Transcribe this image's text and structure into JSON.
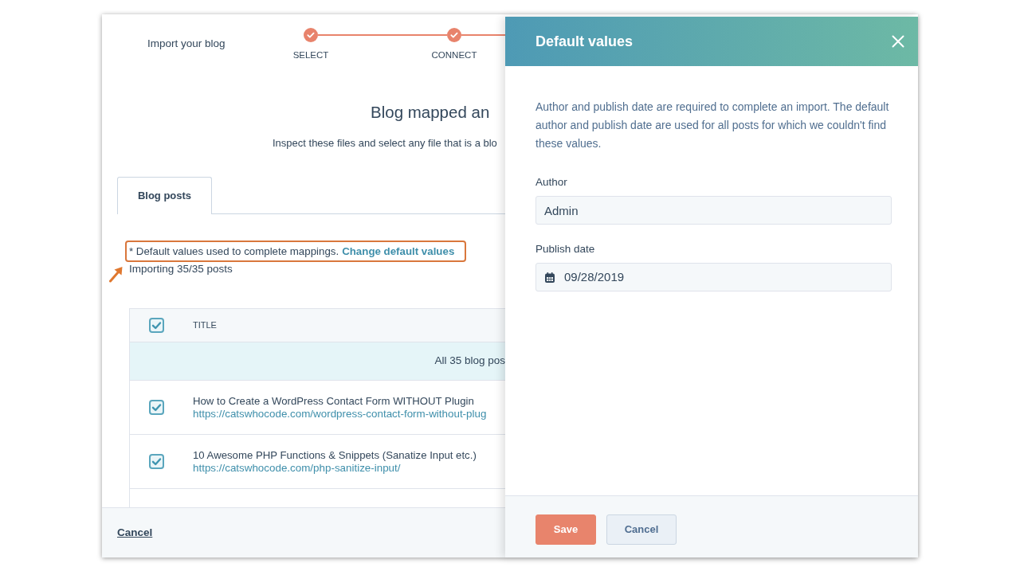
{
  "wizard": {
    "title": "Import your blog",
    "steps": [
      {
        "label": "SELECT",
        "completed": true
      },
      {
        "label": "CONNECT",
        "completed": true
      }
    ]
  },
  "heading": "Blog mapped an",
  "subheading": "Inspect these files and select any file that is a blo",
  "tabs": [
    {
      "label": "Blog posts",
      "selected": true
    }
  ],
  "notice": {
    "text": "* Default values used to complete mappings.",
    "link": "Change default values",
    "highlighted": true
  },
  "import_status": "Importing 35/35 posts",
  "table": {
    "header_checked": true,
    "columns": [
      "TITLE"
    ],
    "banner": "All 35 blog pos",
    "rows": [
      {
        "checked": true,
        "title": "How to Create a WordPress Contact Form WITHOUT Plugin",
        "url": "https://catswhocode.com/wordpress-contact-form-without-plug"
      },
      {
        "checked": true,
        "title": "10 Awesome PHP Functions & Snippets (Sanatize Input etc.)",
        "url": "https://catswhocode.com/php-sanitize-input/"
      }
    ]
  },
  "footer": {
    "cancel": "Cancel"
  },
  "panel": {
    "title": "Default values",
    "description": "Author and publish date are required to complete an import. The default author and publish date are used for all posts for which we couldn't find these values.",
    "fields": [
      {
        "label": "Author",
        "value": "Admin",
        "kind": "text"
      },
      {
        "label": "Publish date",
        "value": "09/28/2019",
        "kind": "date"
      }
    ],
    "buttons": [
      {
        "label": "Save",
        "kind": "save"
      },
      {
        "label": "Cancel",
        "kind": "cancel"
      }
    ]
  }
}
